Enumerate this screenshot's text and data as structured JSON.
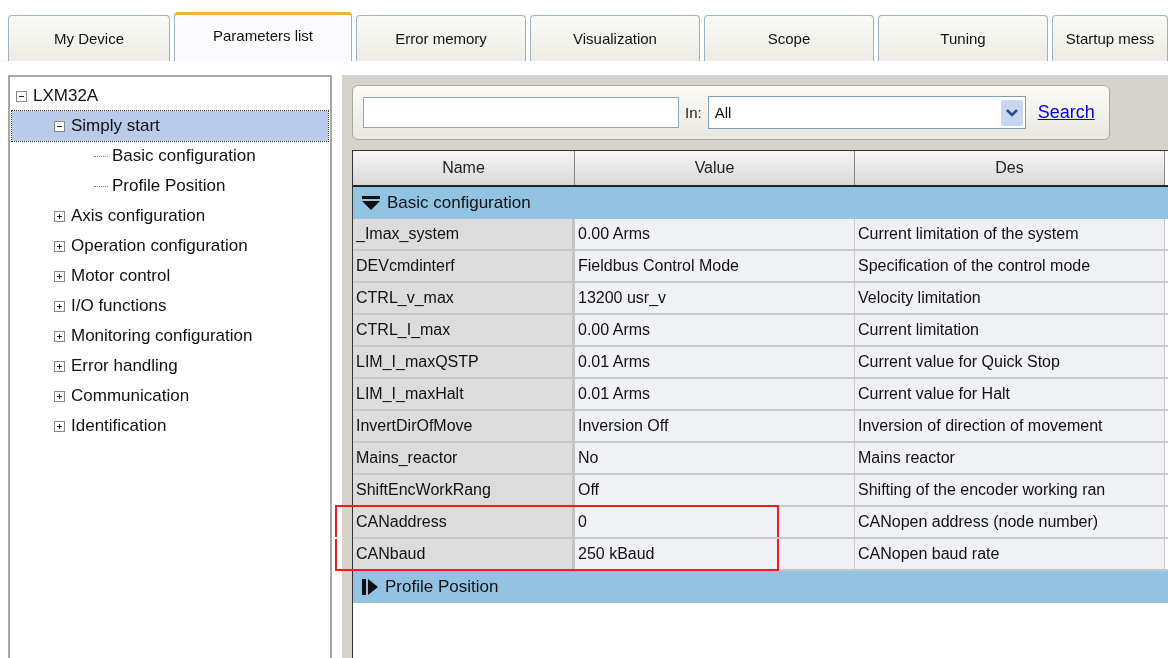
{
  "tabs": [
    {
      "label": "My Device",
      "selected": false
    },
    {
      "label": "Parameters list",
      "selected": true
    },
    {
      "label": "Error memory",
      "selected": false
    },
    {
      "label": "Visualization",
      "selected": false
    },
    {
      "label": "Scope",
      "selected": false
    },
    {
      "label": "Tuning",
      "selected": false
    },
    {
      "label": "Startup mess",
      "selected": false
    }
  ],
  "tree": [
    {
      "label": "LXM32A",
      "expanded": true,
      "selected": false,
      "children": [
        {
          "label": "Simply start",
          "expanded": true,
          "selected": true,
          "children": [
            {
              "label": "Basic configuration",
              "selected": false
            },
            {
              "label": "Profile Position",
              "selected": false
            }
          ]
        },
        {
          "label": "Axis configuration",
          "expanded": false,
          "selected": false
        },
        {
          "label": "Operation configuration",
          "expanded": false,
          "selected": false
        },
        {
          "label": "Motor control",
          "expanded": false,
          "selected": false
        },
        {
          "label": "I/O functions",
          "expanded": false,
          "selected": false
        },
        {
          "label": "Monitoring configuration",
          "expanded": false,
          "selected": false
        },
        {
          "label": "Error handling",
          "expanded": false,
          "selected": false
        },
        {
          "label": "Communication",
          "expanded": false,
          "selected": false
        },
        {
          "label": "Identification",
          "expanded": false,
          "selected": false
        }
      ]
    }
  ],
  "search": {
    "in_label": "In:",
    "scope": "All",
    "link": "Search"
  },
  "table": {
    "columns": [
      "Name",
      "Value",
      "Des"
    ],
    "groups": [
      {
        "label": "Basic configuration",
        "expanded": true,
        "rows": [
          {
            "name": "_Imax_system",
            "value": "0.00 Arms",
            "description": "Current limitation of the system",
            "highlighted": false
          },
          {
            "name": "DEVcmdinterf",
            "value": "Fieldbus Control Mode",
            "description": "Specification of the control mode",
            "highlighted": false
          },
          {
            "name": "CTRL_v_max",
            "value": "13200 usr_v",
            "description": "Velocity limitation",
            "highlighted": false
          },
          {
            "name": "CTRL_I_max",
            "value": "0.00 Arms",
            "description": "Current limitation",
            "highlighted": false
          },
          {
            "name": "LIM_I_maxQSTP",
            "value": "0.01 Arms",
            "description": "Current value for Quick Stop",
            "highlighted": false
          },
          {
            "name": "LIM_I_maxHalt",
            "value": "0.01 Arms",
            "description": "Current value for Halt",
            "highlighted": false
          },
          {
            "name": "InvertDirOfMove",
            "value": "Inversion Off",
            "description": "Inversion of direction of movement",
            "highlighted": false
          },
          {
            "name": "Mains_reactor",
            "value": "No",
            "description": "Mains reactor",
            "highlighted": false
          },
          {
            "name": "ShiftEncWorkRang",
            "value": "Off",
            "description": "Shifting of the encoder working ran",
            "highlighted": false
          },
          {
            "name": "CANaddress",
            "value": "0",
            "description": "CANopen address (node number)",
            "highlighted": true
          },
          {
            "name": "CANbaud",
            "value": "250 kBaud",
            "description": "CANopen baud rate",
            "highlighted": true
          }
        ]
      },
      {
        "label": "Profile Position",
        "expanded": false
      }
    ]
  }
}
